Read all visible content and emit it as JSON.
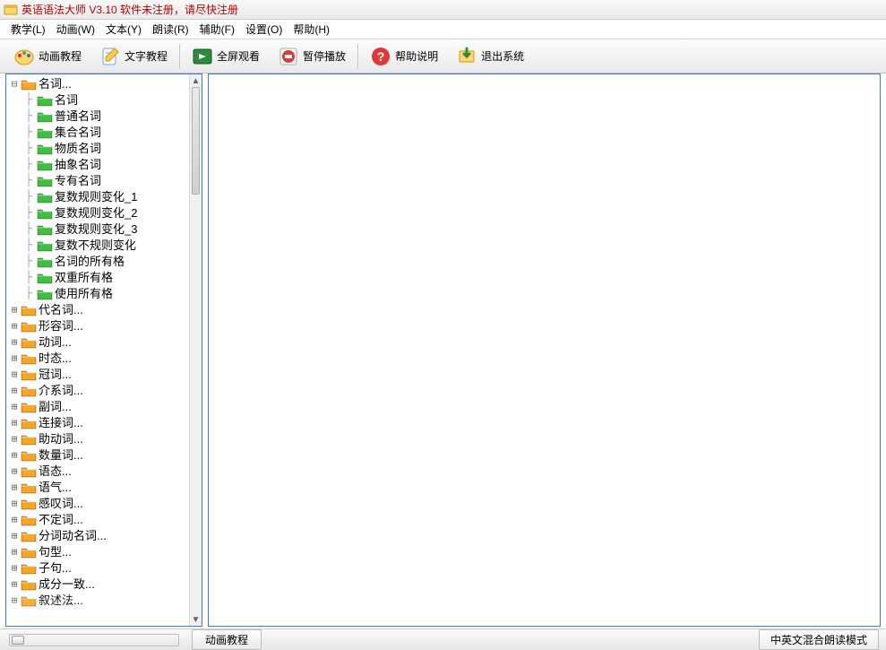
{
  "title": "英语语法大师 V3.10 软件未注册，请尽快注册",
  "menu": [
    "教学(L)",
    "动画(W)",
    "文本(Y)",
    "朗读(R)",
    "辅助(F)",
    "设置(O)",
    "帮助(H)"
  ],
  "toolbar": [
    {
      "label": "动画教程",
      "name": "animation-tutorial"
    },
    {
      "label": "文字教程",
      "name": "text-tutorial"
    },
    {
      "label": "全屏观看",
      "name": "fullscreen"
    },
    {
      "label": "暂停播放",
      "name": "pause"
    },
    {
      "label": "帮助说明",
      "name": "help"
    },
    {
      "label": "退出系统",
      "name": "exit"
    }
  ],
  "tree": {
    "root": "名词...",
    "children": [
      "名词",
      "普通名词",
      "集合名词",
      "物质名词",
      "抽象名词",
      "专有名词",
      "复数规则变化_1",
      "复数规则变化_2",
      "复数规则变化_3",
      "复数不规则变化",
      "名词的所有格",
      "双重所有格",
      "使用所有格"
    ],
    "siblings": [
      "代名词...",
      "形容词...",
      "动词...",
      "时态...",
      "冠词...",
      "介系词...",
      "副词...",
      "连接词...",
      "助动词...",
      "数量词...",
      "语态...",
      "语气...",
      "感叹词...",
      "不定词...",
      "分词动名词...",
      "句型...",
      "子句...",
      "成分一致..."
    ]
  },
  "status": {
    "button": "动画教程",
    "mode": "中英文混合朗读模式"
  }
}
